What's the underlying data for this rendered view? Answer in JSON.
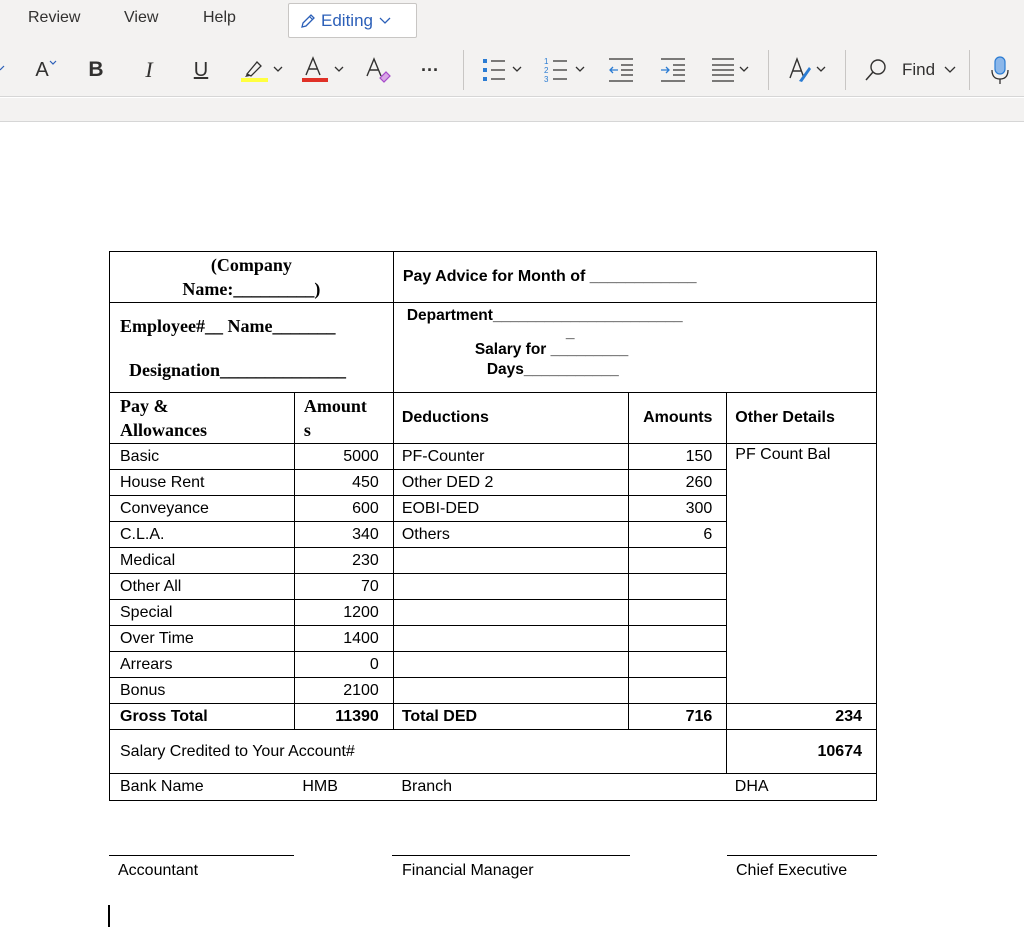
{
  "ribbon": {
    "tabs": [
      "Review",
      "View",
      "Help"
    ],
    "editing_label": "Editing",
    "find_label": "Find",
    "icons": [
      "grow-font-icon",
      "bold-icon",
      "italic-icon",
      "underline-icon",
      "highlight-icon",
      "font-color-icon",
      "clear-formatting-icon",
      "more-icon",
      "bullets-icon",
      "numbering-icon",
      "decrease-indent-icon",
      "increase-indent-icon",
      "align-icon",
      "styles-icon",
      "find-icon",
      "dictate-icon"
    ],
    "tool_glyphs": {
      "bold": "B",
      "italic": "I",
      "underline": "U",
      "font_color": "A",
      "grow_font": "A",
      "more": "···"
    },
    "colors": {
      "accent": "#2b5fb8",
      "highlight": "#ffff3f",
      "font_color": "#e03127"
    }
  },
  "payslip": {
    "company": "(Company Name:_________)",
    "company_line1": "(Company",
    "company_line2": "Name:_________)",
    "month": "Pay Advice for Month of ____________",
    "employee": "Employee#__  Name_______",
    "department": "Department______________________",
    "department_extra": "_",
    "designation": "Designation______________",
    "salary_for": "Salary for _________",
    "days": "Days___________",
    "headers": {
      "pay": "Pay & Allowances",
      "pay_line1": "Pay &",
      "pay_line2": "Allowances",
      "amounts_line1": "Amount",
      "amounts_line2": "s",
      "deductions": "Deductions",
      "ded_amounts": "Amounts",
      "other": "Other Details"
    },
    "rows": [
      {
        "pay": "Basic",
        "amount": "5000",
        "ded": "PF-Counter",
        "ded_amount": "150"
      },
      {
        "pay": "House Rent",
        "amount": "450",
        "ded": "Other DED 2",
        "ded_amount": "260"
      },
      {
        "pay": "Conveyance",
        "amount": "600",
        "ded": "EOBI-DED",
        "ded_amount": "300"
      },
      {
        "pay": "C.L.A.",
        "amount": "340",
        "ded": "Others",
        "ded_amount": "6"
      },
      {
        "pay": "Medical",
        "amount": "230",
        "ded": "",
        "ded_amount": ""
      },
      {
        "pay": "Other All",
        "amount": "70",
        "ded": "",
        "ded_amount": ""
      },
      {
        "pay": "Special",
        "amount": "1200",
        "ded": "",
        "ded_amount": ""
      },
      {
        "pay": "Over Time",
        "amount": "1400",
        "ded": "",
        "ded_amount": ""
      },
      {
        "pay": "Arrears",
        "amount": "0",
        "ded": "",
        "ded_amount": ""
      },
      {
        "pay": "Bonus",
        "amount": "2100",
        "ded": "",
        "ded_amount": ""
      }
    ],
    "other_details": "PF Count Bal",
    "gross_total_label": "Gross Total",
    "gross_total": "11390",
    "total_ded_label": "Total DED",
    "total_ded": "716",
    "other_total": "234",
    "credited_label": "Salary Credited to Your Account#",
    "net_salary": "10674",
    "bank_label": "Bank Name",
    "bank_value": "HMB",
    "branch_label": "Branch",
    "branch_value": "DHA"
  },
  "signatures": [
    "Accountant",
    "Financial Manager",
    "Chief Executive"
  ]
}
